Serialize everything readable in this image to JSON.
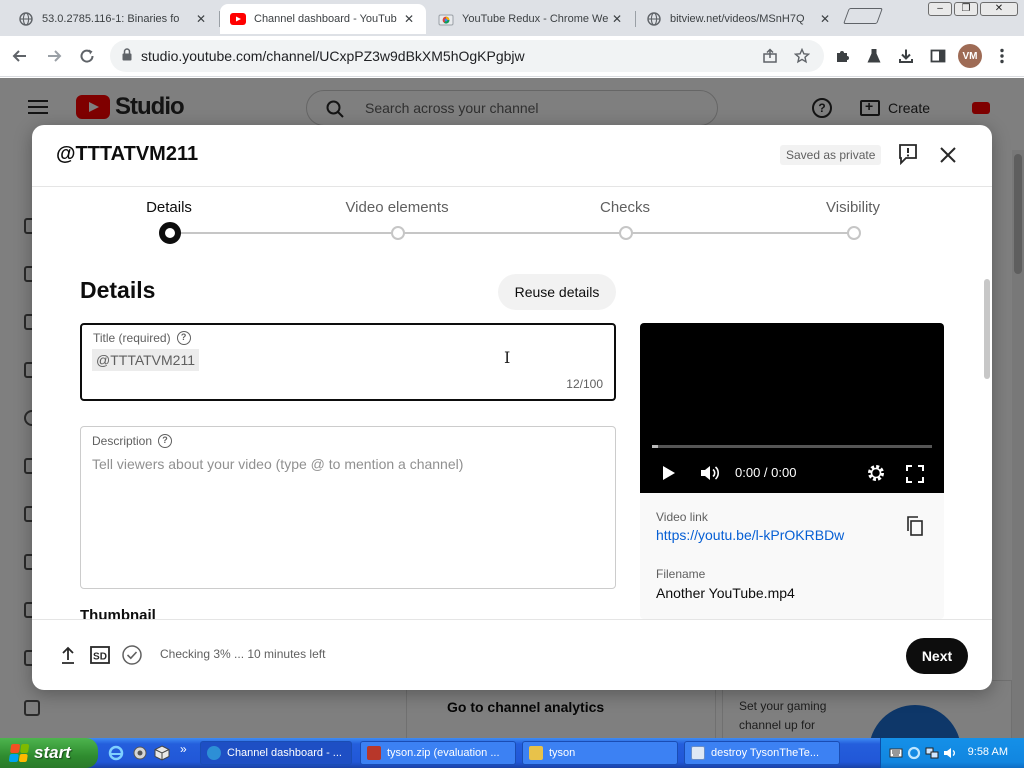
{
  "browser": {
    "tabs": [
      {
        "title": "53.0.2785.116-1: Binaries fo",
        "active": false
      },
      {
        "title": "Channel dashboard - YouTub",
        "active": true
      },
      {
        "title": "YouTube Redux - Chrome We",
        "active": false
      },
      {
        "title": "bitview.net/videos/MSnH7Q",
        "active": false
      }
    ],
    "close_glyph": "✕",
    "url": "studio.youtube.com/channel/UCxpPZ3w9dBkXM5hOgKPgbjw",
    "profile_initials": "VM",
    "window_controls": [
      "–",
      "❐",
      "✕"
    ]
  },
  "studio": {
    "brand": "Studio",
    "search_placeholder": "Search across your channel",
    "help_glyph": "?",
    "create_label": "Create",
    "analytics_label": "Go to channel analytics",
    "gaming_text": "Set your gaming channel up for"
  },
  "dialog": {
    "title": "@TTTATVM211",
    "saved_label": "Saved as private",
    "steps": [
      {
        "label": "Details",
        "active": true
      },
      {
        "label": "Video elements",
        "active": false
      },
      {
        "label": "Checks",
        "active": false
      },
      {
        "label": "Visibility",
        "active": false
      }
    ],
    "section_title": "Details",
    "reuse_label": "Reuse details",
    "title_field": {
      "label": "Title (required)",
      "value": "@TTTATVM211",
      "counter": "12/100"
    },
    "description_field": {
      "label": "Description",
      "placeholder": "Tell viewers about your video (type @ to mention a channel)"
    },
    "thumbnail_title": "Thumbnail",
    "preview": {
      "time": "0:00 / 0:00",
      "progress": 0.02,
      "video_link_label": "Video link",
      "video_link": "https://youtu.be/l-kPrOKRBDw",
      "filename_label": "Filename",
      "filename": "Another YouTube.mp4"
    },
    "footer": {
      "quality_badge": "SD",
      "status": "Checking 3% ... 10 minutes left",
      "next_label": "Next"
    }
  },
  "taskbar": {
    "start_label": "start",
    "tasks": [
      {
        "label": "Channel dashboard - ...",
        "active": true,
        "icon_color": "#2d8fd6"
      },
      {
        "label": "tyson.zip (evaluation ...",
        "active": false,
        "icon_color": "#b8372a"
      },
      {
        "label": "tyson",
        "active": false,
        "icon_color": "#e8c24a"
      },
      {
        "label": "destroy TysonTheTe...",
        "active": false,
        "icon_color": "#dfe8f5"
      }
    ],
    "clock": "9:58 AM",
    "quicklaunch_more": "»"
  }
}
